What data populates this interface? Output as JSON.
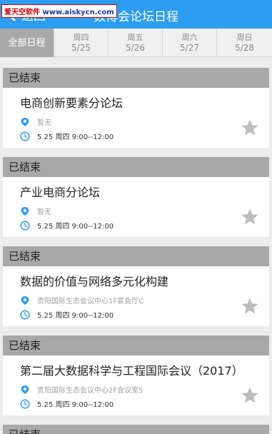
{
  "header": {
    "back_label": "返回",
    "title": "数博会论坛日程"
  },
  "watermark": {
    "text": "爱天空软件",
    "url": "www.aiskycn.com"
  },
  "tabs": [
    {
      "label": "全部日程",
      "active": true
    },
    {
      "weekday": "周四",
      "date": "5/25"
    },
    {
      "weekday": "周五",
      "date": "5/26"
    },
    {
      "weekday": "周六",
      "date": "5/27"
    },
    {
      "weekday": "周日",
      "date": "5/28"
    }
  ],
  "sections": [
    {
      "status": "已结束",
      "title": "电商创新要素分论坛",
      "location": "暂无",
      "time": "5.25 周四 9:00--12:00"
    },
    {
      "status": "已结束",
      "title": "产业电商分论坛",
      "location": "暂无",
      "time": "5.25 周四 9:00--12:00"
    },
    {
      "status": "已结束",
      "title": "数据的价值与网络多元化构建",
      "location": "贵阳国际生态会议中心1F宴会厅C",
      "time": "5.25 周四 9:00--12:00"
    },
    {
      "status": "已结束",
      "title": "第二届大数据科学与工程国际会议（2017）",
      "location": "贵阳国际生态会议中心2F会议室5",
      "time": "5.25 周四 9:00--12:00"
    },
    {
      "status": "已结束"
    }
  ],
  "colors": {
    "header_bg": "#2c9df0",
    "icon_blue": "#2c9df0",
    "section_bg": "#a8a8a8",
    "star": "#bdbdbd"
  },
  "icons": {
    "location": "location-pin-icon",
    "time": "clock-icon",
    "favorite": "star-icon",
    "back": "chevron-left-icon"
  }
}
